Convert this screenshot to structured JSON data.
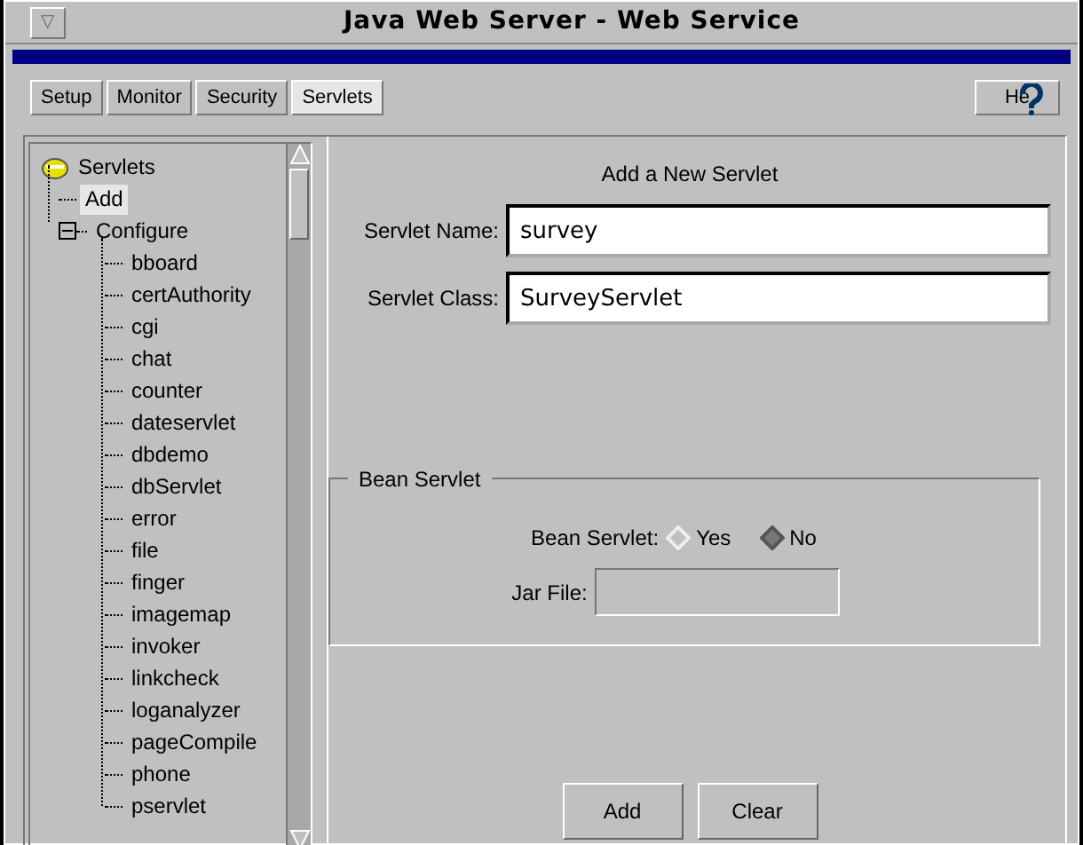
{
  "window": {
    "title": "Java Web Server - Web Service",
    "menu_glyph": "▽"
  },
  "tabs": [
    {
      "label": "Setup",
      "selected": false
    },
    {
      "label": "Monitor",
      "selected": false
    },
    {
      "label": "Security",
      "selected": false
    },
    {
      "label": "Servlets",
      "selected": true
    }
  ],
  "help_button": {
    "label": "He"
  },
  "tree": [
    {
      "label": "Servlets",
      "selected": false,
      "children": [
        {
          "label": "Add",
          "selected": true
        },
        {
          "label": "Configure",
          "selected": false,
          "expanded": true,
          "children": [
            {
              "label": "bboard",
              "selected": false
            },
            {
              "label": "certAuthority",
              "selected": false
            },
            {
              "label": "cgi",
              "selected": false
            },
            {
              "label": "chat",
              "selected": false
            },
            {
              "label": "counter",
              "selected": false
            },
            {
              "label": "dateservlet",
              "selected": false
            },
            {
              "label": "dbdemo",
              "selected": false
            },
            {
              "label": "dbServlet",
              "selected": false
            },
            {
              "label": "error",
              "selected": false
            },
            {
              "label": "file",
              "selected": false
            },
            {
              "label": "finger",
              "selected": false
            },
            {
              "label": "imagemap",
              "selected": false
            },
            {
              "label": "invoker",
              "selected": false
            },
            {
              "label": "linkcheck",
              "selected": false
            },
            {
              "label": "loganalyzer",
              "selected": false
            },
            {
              "label": "pageCompile",
              "selected": false
            },
            {
              "label": "phone",
              "selected": false
            },
            {
              "label": "pservlet",
              "selected": false
            }
          ]
        }
      ]
    }
  ],
  "form": {
    "heading": "Add a New Servlet",
    "fields": [
      {
        "label": "Servlet Name:",
        "value": "survey"
      },
      {
        "label": "Servlet Class:",
        "value": "SurveyServlet"
      }
    ],
    "bean_group": {
      "title": "Bean Servlet",
      "radio_label": "Bean Servlet:",
      "options": [
        {
          "label": "Yes",
          "selected": false
        },
        {
          "label": "No",
          "selected": true
        }
      ],
      "jar_label": "Jar File:",
      "jar_disabled": true
    },
    "buttons": [
      "Add",
      "Clear"
    ]
  }
}
